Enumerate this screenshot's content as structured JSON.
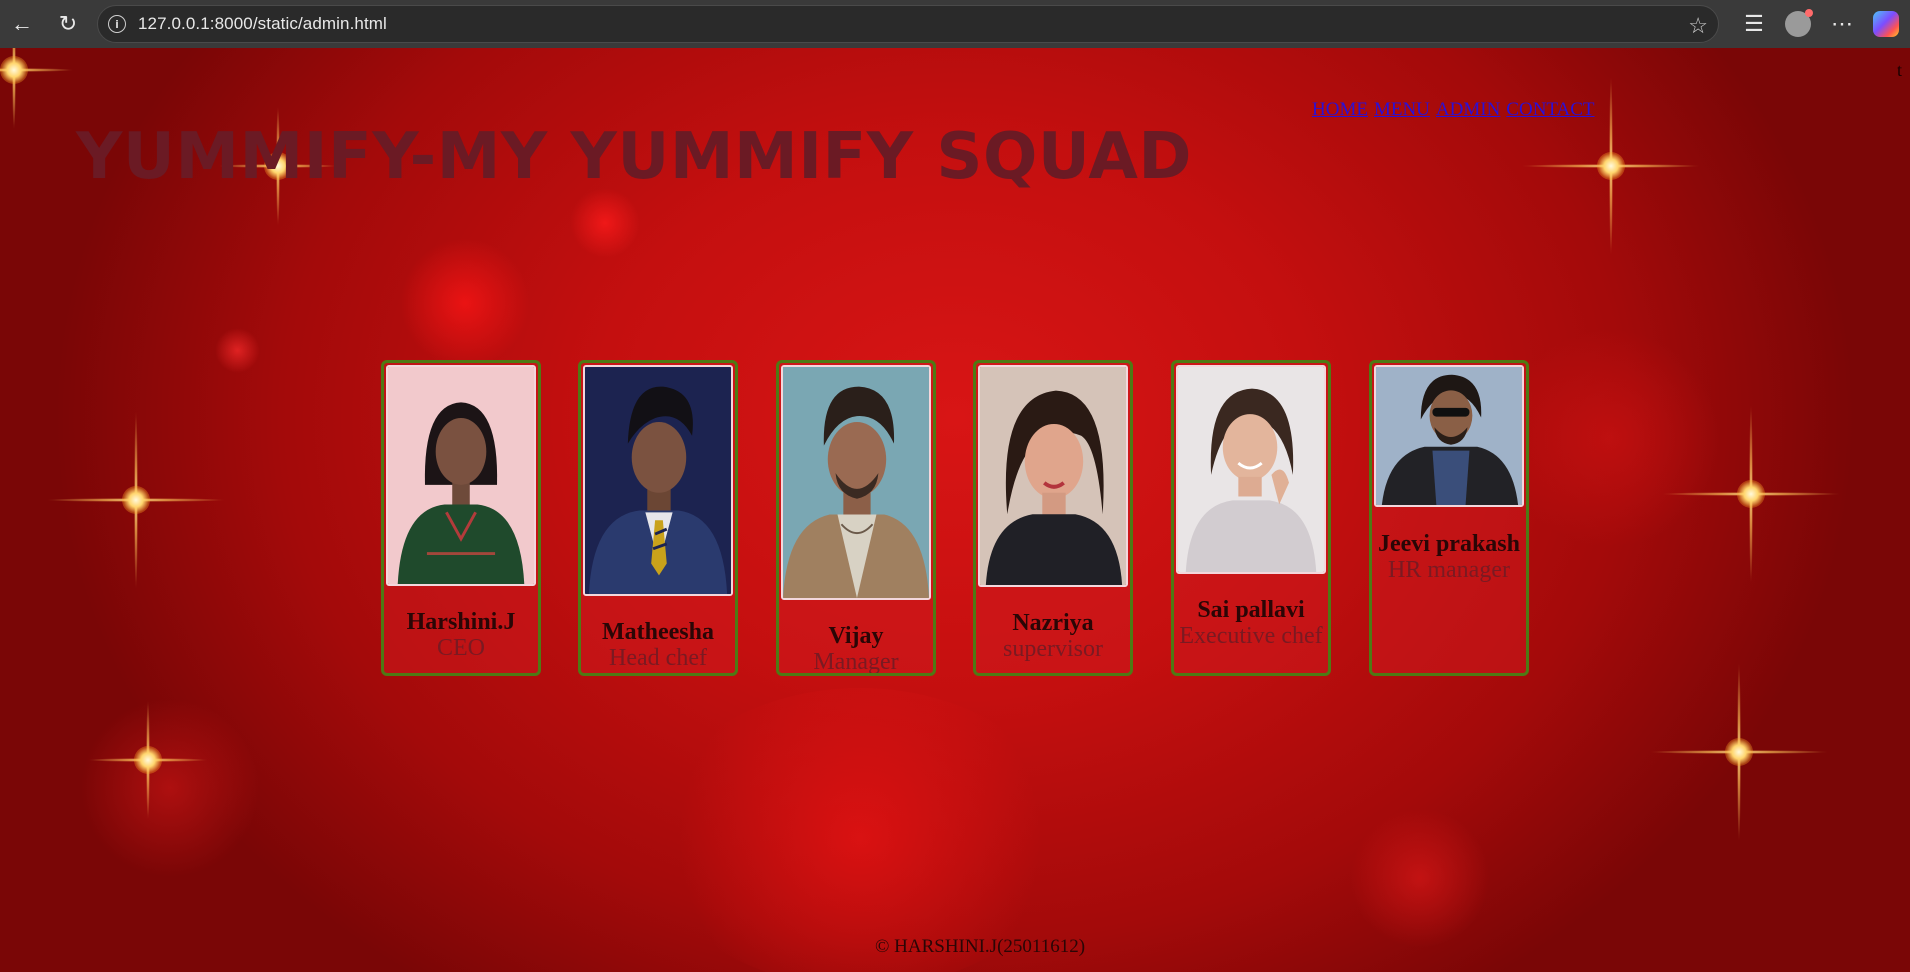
{
  "browser": {
    "url": "127.0.0.1:8000/static/admin.html",
    "icons": [
      "back-icon",
      "reload-icon",
      "info-icon",
      "star-icon",
      "favorites-icon",
      "profile-icon",
      "more-icon",
      "copilot-icon"
    ]
  },
  "site": {
    "title": "YUMMIFY-MY YUMMIFY SQUAD",
    "corner_char": "t",
    "nav": [
      "HOME",
      "MENU",
      "ADMIN",
      "CONTACT"
    ]
  },
  "team": [
    {
      "name": "Harshini.J",
      "role": "CEO"
    },
    {
      "name": "Matheesha",
      "role": "Head chef"
    },
    {
      "name": "Vijay",
      "role": "Manager"
    },
    {
      "name": "Nazriya",
      "role": "supervisor"
    },
    {
      "name": "Sai pallavi",
      "role": "Executive chef"
    },
    {
      "name": "Jeevi prakash",
      "role": "HR manager"
    }
  ],
  "footer": "© HARSHINI.J(25011612)",
  "colors": {
    "background": "#c40f0f",
    "title": "#6b1a24",
    "nav_link": "#2b10d6",
    "card_border": "#4e7a14"
  }
}
